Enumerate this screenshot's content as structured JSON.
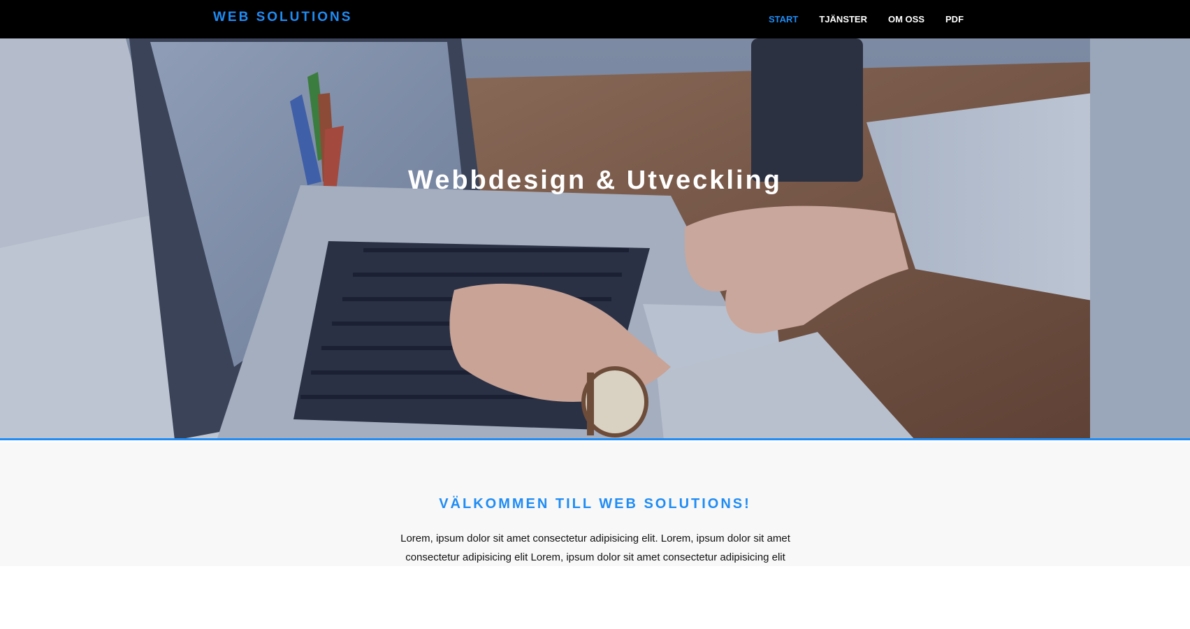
{
  "header": {
    "brand": "WEB SOLUTIONS",
    "nav": [
      {
        "label": "START",
        "active": true
      },
      {
        "label": "TJÄNSTER",
        "active": false
      },
      {
        "label": "OM OSS",
        "active": false
      },
      {
        "label": "PDF",
        "active": false
      }
    ]
  },
  "hero": {
    "title": "Webbdesign & Utveckling",
    "image": "laptop-typing-photo"
  },
  "welcome": {
    "heading": "VÄLKOMMEN TILL WEB SOLUTIONS!",
    "text": "Lorem, ipsum dolor sit amet consectetur adipisicing elit. Lorem, ipsum dolor sit amet consectetur adipisicing elit Lorem, ipsum dolor sit amet consectetur adipisicing elit"
  },
  "colors": {
    "accent": "#1f8cf5",
    "navbar": "#000000",
    "section_bg": "#f8f8f8"
  }
}
